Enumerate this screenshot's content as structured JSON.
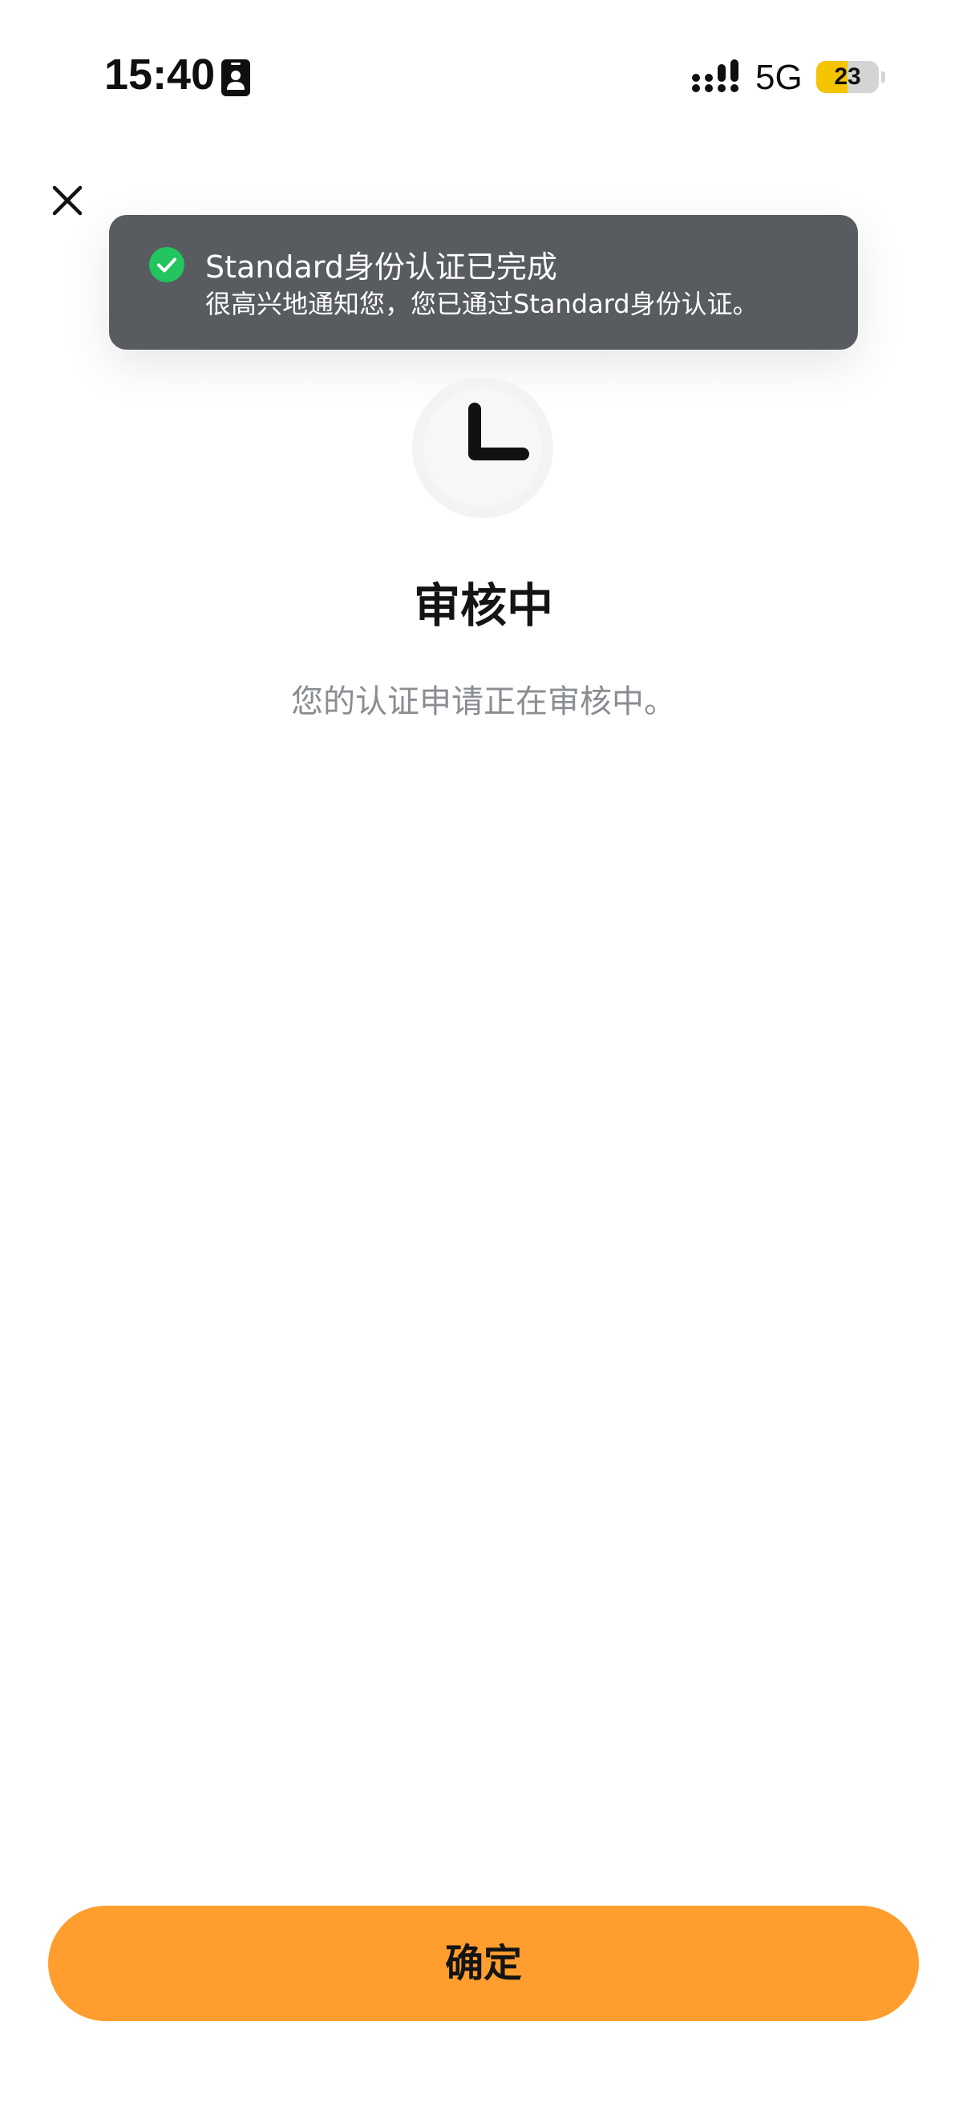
{
  "status_bar": {
    "time": "15:40",
    "network": "5G",
    "battery_level": "23",
    "battery_fraction": 0.5
  },
  "toast": {
    "title": "Standard身份认证已完成",
    "message": "很高兴地通知您，您已通过Standard身份认证。",
    "accent_color": "#22c55e"
  },
  "main": {
    "status_icon": "clock-icon",
    "title": "审核中",
    "subtitle": "您的认证申请正在审核中。"
  },
  "actions": {
    "confirm_label": "确定",
    "confirm_color": "#ff9e2e"
  }
}
